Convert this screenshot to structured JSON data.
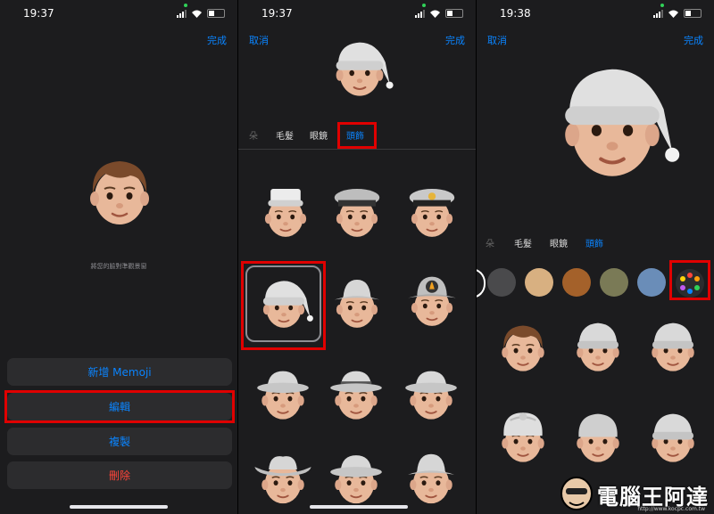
{
  "panels": [
    {
      "time": "19:37",
      "done_label": "完成",
      "hint": "將您的臉對準觀景窗",
      "buttons": [
        "新增 Memoji",
        "編輯",
        "複製",
        "刪除"
      ]
    },
    {
      "time": "19:37",
      "cancel_label": "取消",
      "done_label": "完成",
      "tabs": [
        "朵",
        "毛髮",
        "眼鏡",
        "頭飾"
      ]
    },
    {
      "time": "19:38",
      "cancel_label": "取消",
      "done_label": "完成",
      "tabs": [
        "朵",
        "毛髮",
        "眼鏡",
        "頭飾"
      ],
      "swatches": [
        "#4a4a4c",
        "#d8b081",
        "#a4612a",
        "#7a7a56",
        "#6a8db8"
      ]
    }
  ],
  "watermark": {
    "text": "電腦王阿達",
    "url": "http://www.kocpc.com.tw"
  },
  "colors": {
    "accent": "#0a84ff",
    "destructive": "#ff453a",
    "highlight": "#e00000"
  }
}
